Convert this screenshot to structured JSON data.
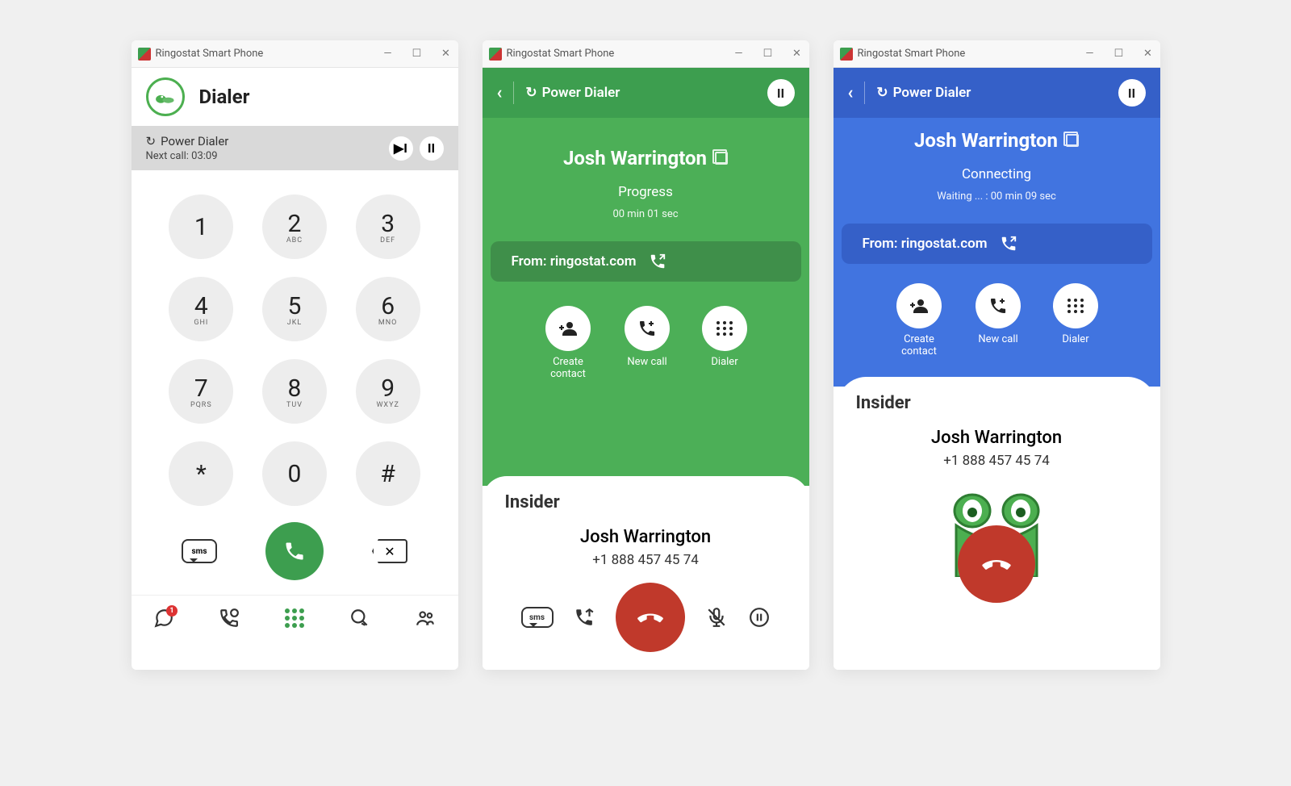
{
  "windows": {
    "title": "Ringostat Smart Phone",
    "win1": {
      "header": "Dialer",
      "pd_label": "Power Dialer",
      "next_call": "Next call: 03:09",
      "keypad": [
        {
          "d": "1",
          "l": ""
        },
        {
          "d": "2",
          "l": "ABC"
        },
        {
          "d": "3",
          "l": "DEF"
        },
        {
          "d": "4",
          "l": "GHI"
        },
        {
          "d": "5",
          "l": "JKL"
        },
        {
          "d": "6",
          "l": "MNO"
        },
        {
          "d": "7",
          "l": "PQRS"
        },
        {
          "d": "8",
          "l": "TUV"
        },
        {
          "d": "9",
          "l": "WXYZ"
        },
        {
          "d": "*",
          "l": ""
        },
        {
          "d": "0",
          "l": ""
        },
        {
          "d": "#",
          "l": ""
        }
      ],
      "sms": "sms",
      "nav_badge": "1"
    },
    "win2": {
      "pd_label": "Power Dialer",
      "contact": "Josh Warrington",
      "status": "Progress",
      "timer": "00 min  01 sec",
      "from": "From: ringostat.com",
      "actions": {
        "create": "Create contact",
        "newcall": "New call",
        "dialer": "Dialer"
      },
      "insider": "Insider",
      "name": "Josh Warrington",
      "phone": "+1 888 457 45 74",
      "sms": "sms"
    },
    "win3": {
      "pd_label": "Power Dialer",
      "contact": "Josh Warrington",
      "status": "Connecting",
      "timer": "Waiting ... : 00 min  09 sec",
      "from": "From: ringostat.com",
      "actions": {
        "create": "Create contact",
        "newcall": "New call",
        "dialer": "Dialer"
      },
      "insider": "Insider",
      "name": "Josh Warrington",
      "phone": "+1 888 457 45 74"
    }
  }
}
